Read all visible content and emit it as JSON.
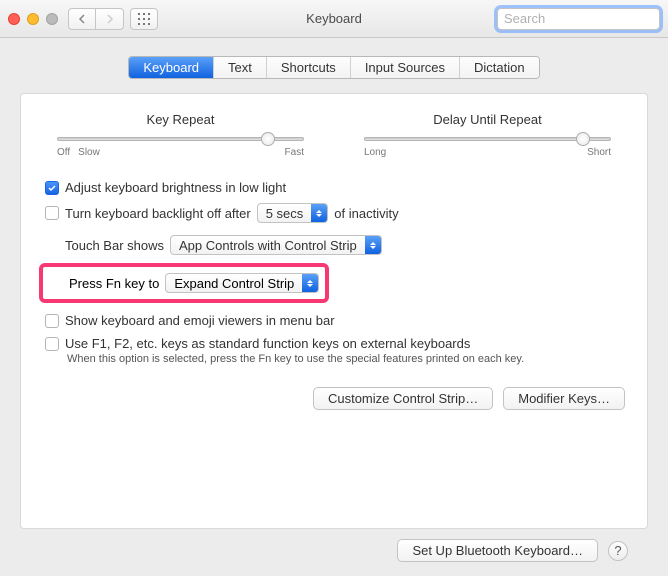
{
  "window_title": "Keyboard",
  "search": {
    "placeholder": "Search"
  },
  "tabs": [
    "Keyboard",
    "Text",
    "Shortcuts",
    "Input Sources",
    "Dictation"
  ],
  "active_tab": 0,
  "sliders": {
    "key_repeat": {
      "title": "Key Repeat",
      "left": "Off",
      "mid": "Slow",
      "right": "Fast",
      "position": 0.88
    },
    "delay": {
      "title": "Delay Until Repeat",
      "left": "Long",
      "right": "Short",
      "position": 0.88
    }
  },
  "options": {
    "adjust_brightness": {
      "label": "Adjust keyboard brightness in low light",
      "checked": true
    },
    "backlight_off": {
      "label_pre": "Turn keyboard backlight off after",
      "label_post": "of inactivity",
      "checked": false,
      "value": "5 secs"
    },
    "touch_bar": {
      "label": "Touch Bar shows",
      "value": "App Controls with Control Strip"
    },
    "fn_key": {
      "label": "Press Fn key to",
      "value": "Expand Control Strip"
    },
    "show_viewers": {
      "label": "Show keyboard and emoji viewers in menu bar",
      "checked": false
    },
    "use_fkeys": {
      "label": "Use F1, F2, etc. keys as standard function keys on external keyboards",
      "checked": false,
      "hint": "When this option is selected, press the Fn key to use the special features printed on each key."
    }
  },
  "buttons": {
    "customize": "Customize Control Strip…",
    "modifier": "Modifier Keys…",
    "bluetooth": "Set Up Bluetooth Keyboard…"
  },
  "help_label": "?"
}
